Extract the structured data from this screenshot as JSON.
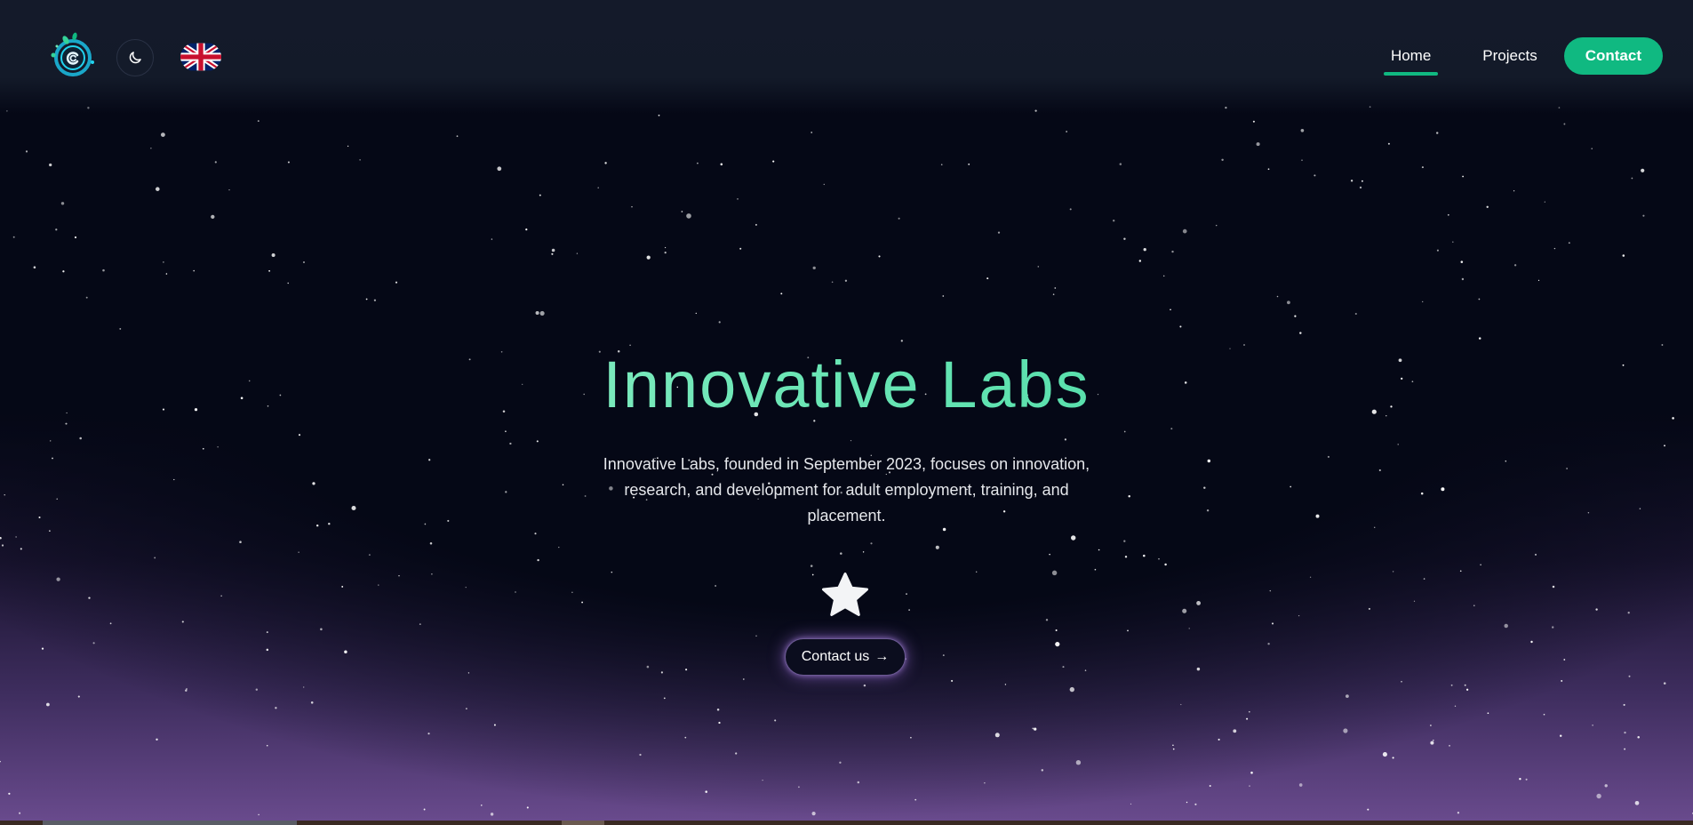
{
  "header": {
    "logo_icon": "swirl-logo-icon",
    "theme_icon": "moon-icon",
    "language_icon": "uk-flag-icon"
  },
  "nav": {
    "home_label": "Home",
    "projects_label": "Projects",
    "contact_label": "Contact",
    "active": "Home",
    "accent_color": "#10b981"
  },
  "hero": {
    "title": "Innovative Labs",
    "description": "Innovative Labs, founded in September 2023, focuses on innovation, research, and development for adult employment, training, and placement.",
    "badge_icon": "star-icon",
    "cta_label": "Contact us",
    "cta_arrow": "→"
  }
}
